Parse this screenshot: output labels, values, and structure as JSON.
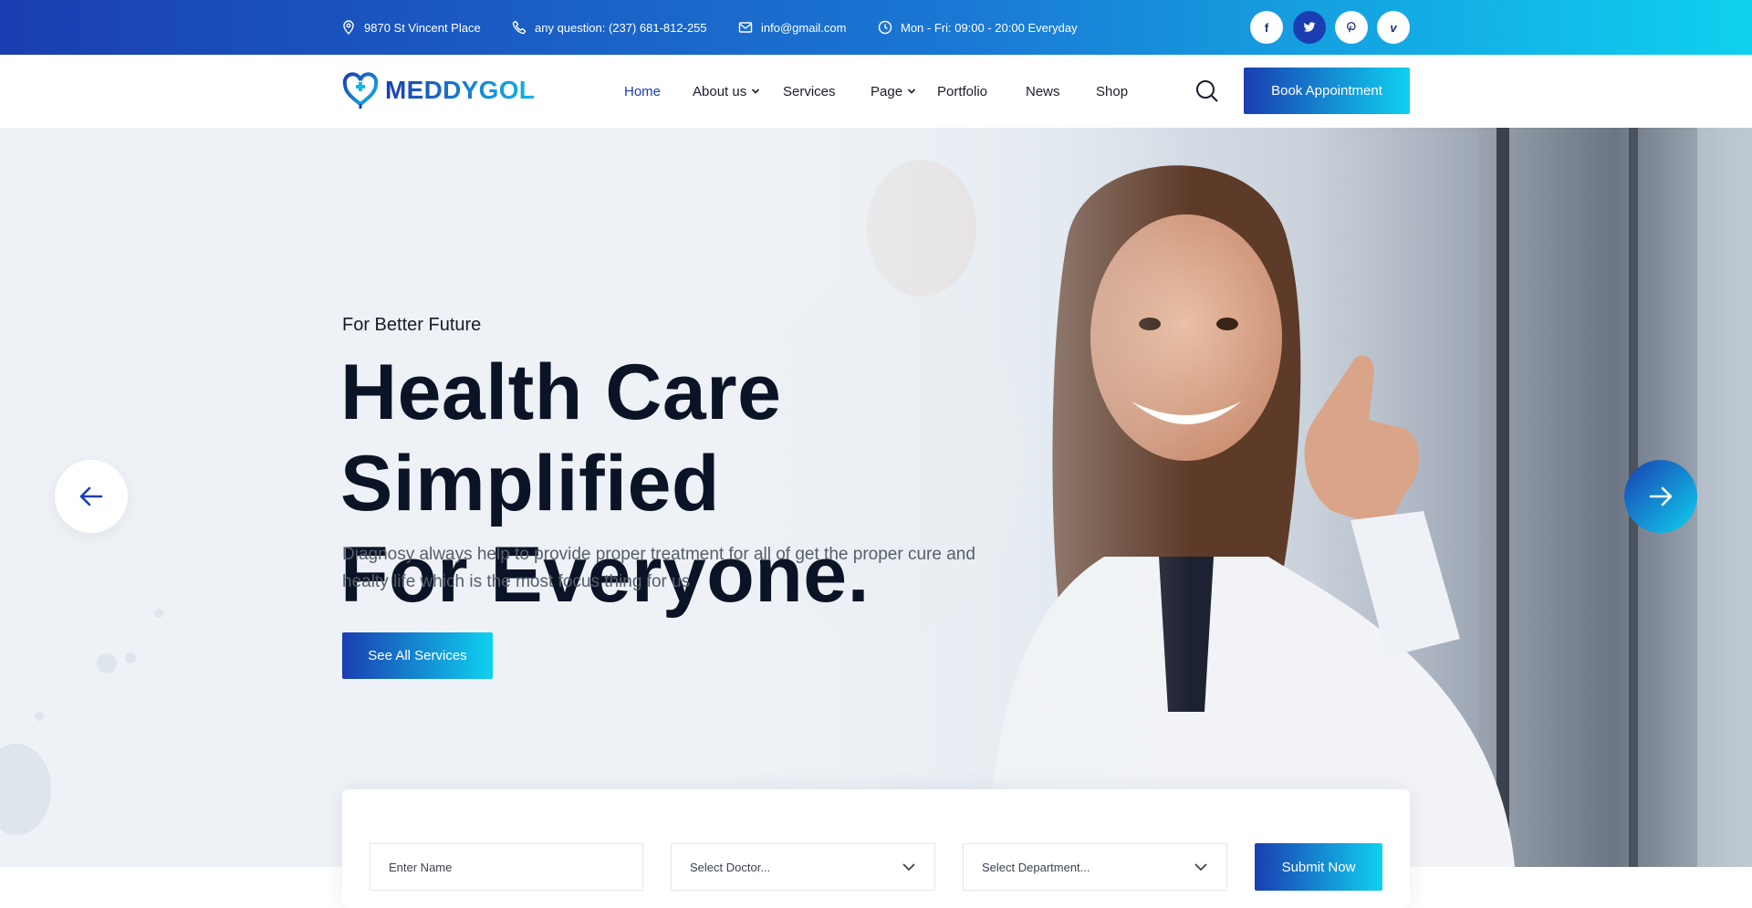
{
  "topbar": {
    "address": "9870 St Vincent Place",
    "phone": "any question: (237) 681-812-255",
    "email": "info@gmail.com",
    "hours": "Mon - Fri: 09:00 - 20:00 Everyday",
    "socials": [
      "facebook-icon",
      "twitter-icon",
      "pinterest-icon",
      "vimeo-icon"
    ]
  },
  "brand": {
    "name": "MEDDYGOL"
  },
  "nav": {
    "home": "Home",
    "about": "About us",
    "services": "Services",
    "page": "Page",
    "portfolio": "Portfolio",
    "news": "News",
    "shop": "Shop",
    "book_label": "Book Appointment"
  },
  "hero": {
    "eyebrow": "For Better Future",
    "title_line1": "Health Care Simplified",
    "title_line2": "For Everyone.",
    "text": "Diagnosy always help to provide proper treatment for all of get the proper cure and healty life which is the most focus thing for us",
    "cta_label": "See All Services"
  },
  "form": {
    "name_placeholder": "Enter Name",
    "doctor_value": "Select Doctor...",
    "department_value": "Select Department...",
    "submit_label": "Submit Now"
  },
  "colors": {
    "primary": "#1a3eb1",
    "accent": "#0fd1ef",
    "heading": "#0b1427"
  }
}
